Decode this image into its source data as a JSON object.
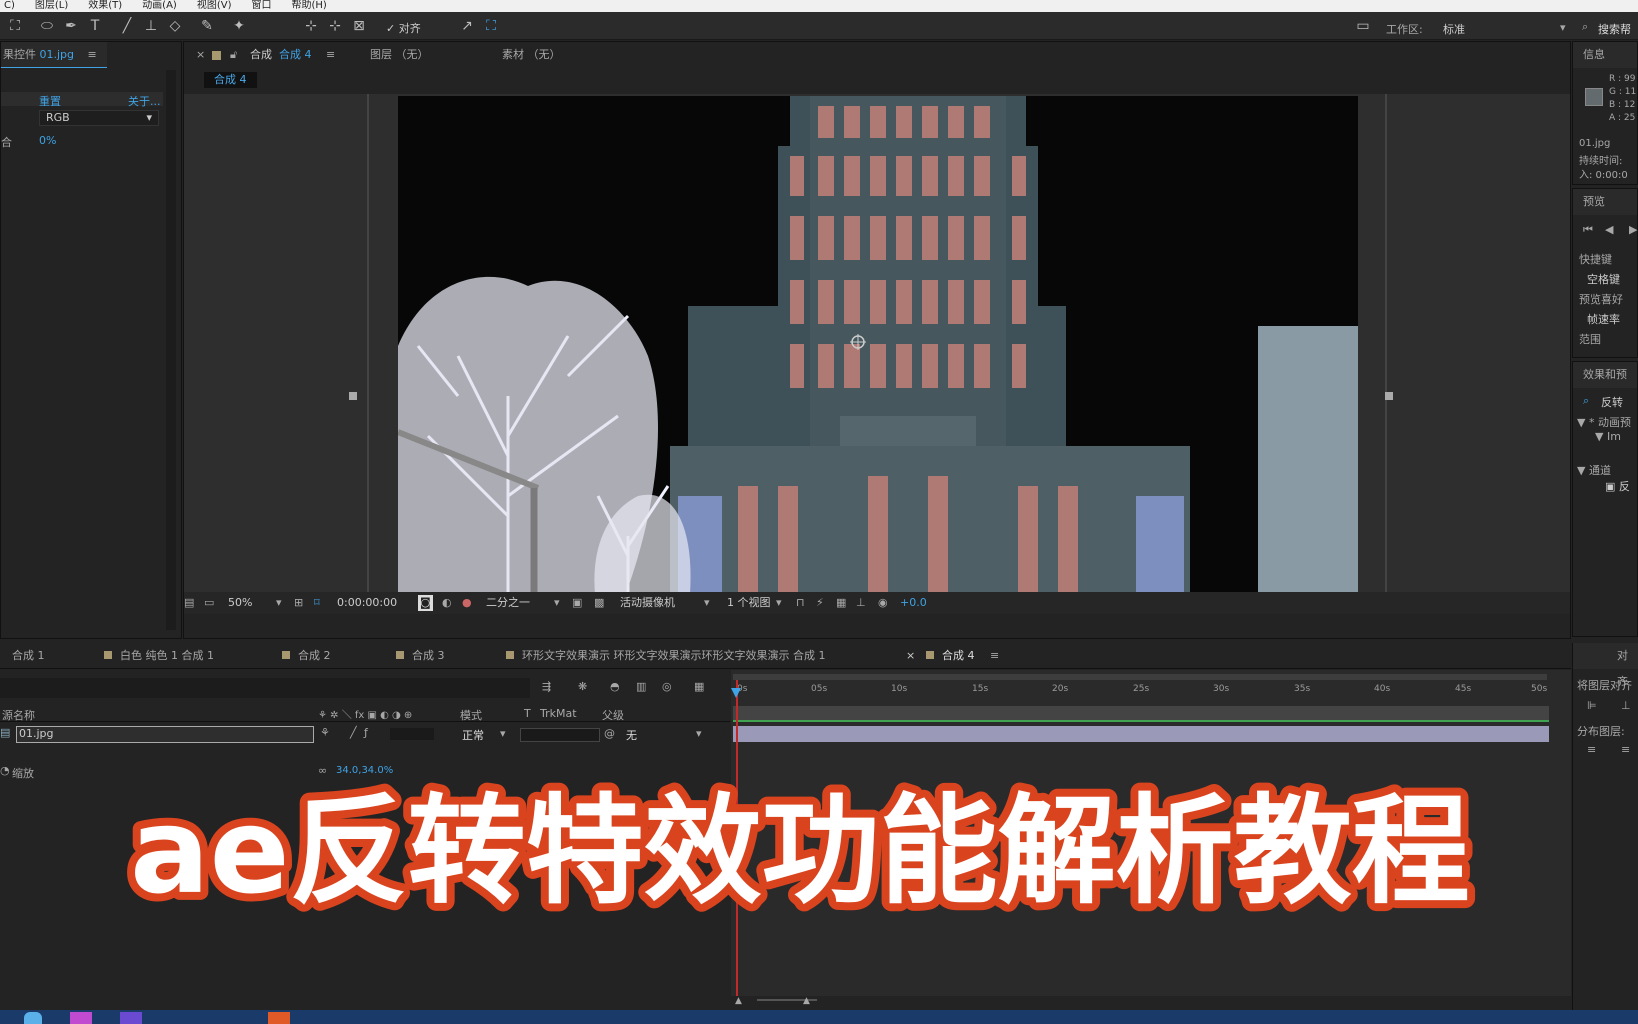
{
  "menu": [
    "C)",
    "图层(L)",
    "效果(T)",
    "动画(A)",
    "视图(V)",
    "窗口",
    "帮助(H)"
  ],
  "toolbar": {
    "align_label": "对齐",
    "workspace_label": "工作区:",
    "workspace_value": "标准",
    "search_label": "搜索帮"
  },
  "effects_panel": {
    "title": "果控件",
    "file": "01.jpg",
    "reset": "重置",
    "about": "关于...",
    "channel_value": "RGB",
    "blend_label": "合",
    "blend_value": "0%"
  },
  "comp_panel": {
    "tab_comp": "合成",
    "tab_comp_name": "合成 4",
    "tab_layer": "图层 （无）",
    "tab_footage": "素材 （无）",
    "breadcrumb": "合成 4",
    "zoom": "50%",
    "timecode": "0:00:00:00",
    "resolution": "二分之一",
    "camera": "活动摄像机",
    "views": "1 个视图",
    "exposure": "+0.0"
  },
  "info_panel": {
    "title": "信息",
    "r": "R : 99",
    "g": "G : 11",
    "b": "B : 12",
    "a": "A : 25",
    "file": "01.jpg",
    "duration": "持续时间:",
    "in": "入: 0:00:0"
  },
  "preview_panel": {
    "title": "预览",
    "shortcut_label": "快捷键",
    "shortcut_value": "空格键",
    "pref_label": "预览喜好",
    "fps_label": "帧速率",
    "range_label": "范围"
  },
  "effects_presets": {
    "title": "效果和预",
    "search": "反转",
    "items": [
      "▼ * 动画预",
      "▼ Im",
      "▼ 通道"
    ]
  },
  "align_panel": {
    "title": "对齐",
    "align_to": "将图层对齐",
    "distribute": "分布图层:"
  },
  "timeline_tabs": [
    "合成 1",
    "白色 纯色 1 合成 1",
    "合成 2",
    "合成 3",
    "环形文字效果演示 环形文字效果演示环形文字效果演示 合成 1",
    "合成 4"
  ],
  "timeline": {
    "col_source": "源名称",
    "col_mode": "模式",
    "col_t": "T",
    "col_trkmat": "TrkMat",
    "col_parent": "父级",
    "layer_name": "01.jpg",
    "layer_mode": "正常",
    "layer_parent": "无",
    "prop_label": "缩放",
    "prop_value": "34.0,34.0%",
    "ruler": [
      "0s",
      "05s",
      "10s",
      "15s",
      "20s",
      "25s",
      "30s",
      "35s",
      "40s",
      "45s",
      "50s"
    ]
  },
  "overlay_title": "ae反转特效功能解析教程",
  "colors": {
    "accent_blue": "#3fa3e6",
    "overlay_stroke": "#d9441f",
    "overlay_fill": "#ffffff",
    "layer_bar": "#9a9ab8"
  }
}
